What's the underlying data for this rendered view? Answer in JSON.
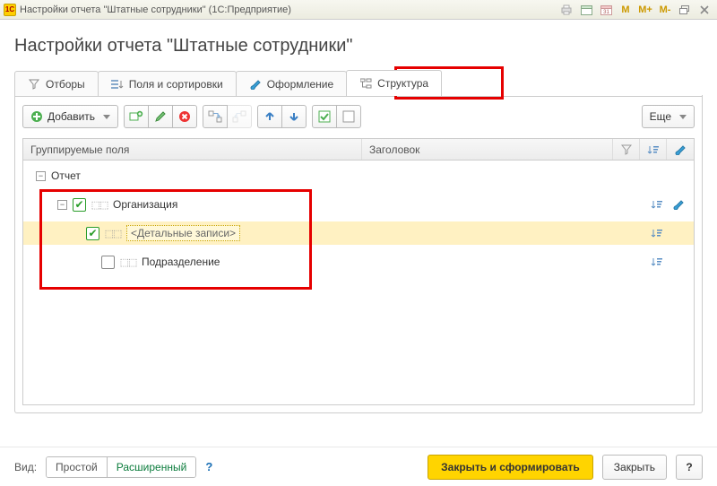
{
  "window": {
    "app_icon": "1C",
    "title": "Настройки отчета \"Штатные сотрудники\"  (1С:Предприятие)"
  },
  "page_title": "Настройки отчета \"Штатные сотрудники\"",
  "tabs": {
    "filters": "Отборы",
    "fields_sort": "Поля и сортировки",
    "design": "Оформление",
    "structure": "Структура"
  },
  "toolbar": {
    "add": "Добавить",
    "more": "Еще"
  },
  "grid": {
    "header_grouped": "Группируемые поля",
    "header_title": "Заголовок"
  },
  "tree": {
    "root": "Отчет",
    "org": "Организация",
    "details": "<Детальные записи>",
    "subdiv": "Подразделение"
  },
  "footer": {
    "view_label": "Вид:",
    "mode_simple": "Простой",
    "mode_advanced": "Расширенный",
    "primary": "Закрыть и сформировать",
    "close": "Закрыть",
    "help": "?"
  }
}
